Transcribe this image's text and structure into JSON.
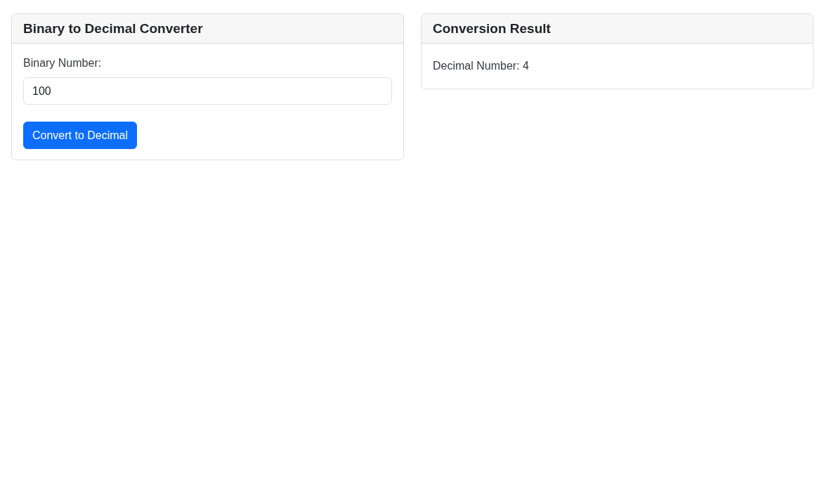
{
  "converter": {
    "title": "Binary to Decimal Converter",
    "field": {
      "label": "Binary Number:",
      "value": "100"
    },
    "button": "Convert to Decimal"
  },
  "result": {
    "title": "Conversion Result",
    "text": "Decimal Number: 4"
  }
}
